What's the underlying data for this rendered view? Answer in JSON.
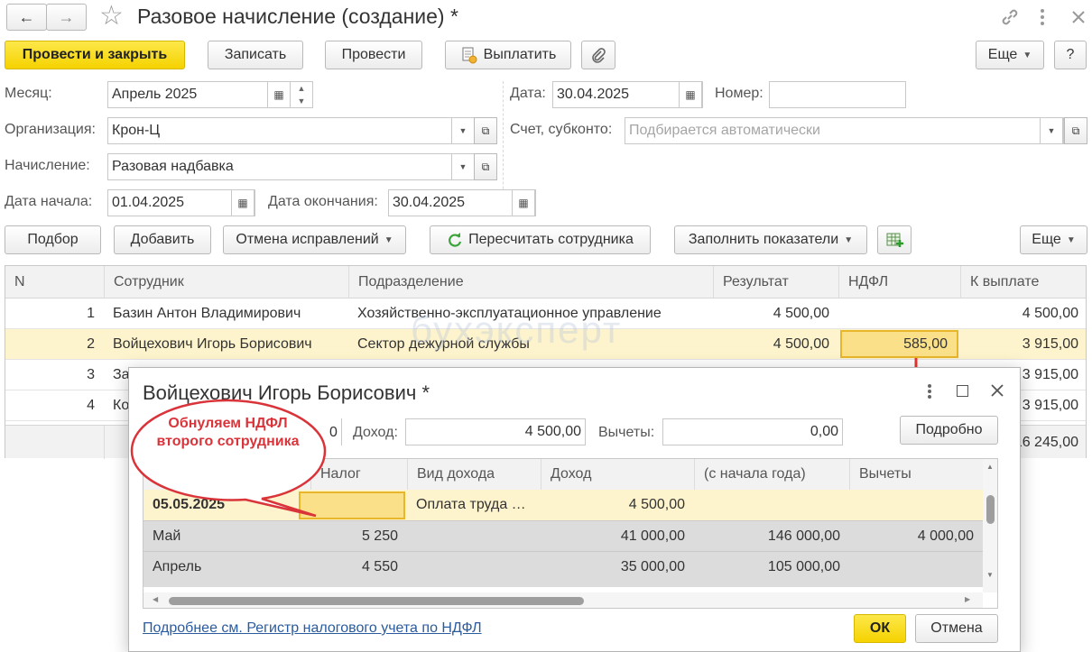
{
  "window": {
    "title": "Разовое начисление (создание) *",
    "nav_back": "←",
    "nav_forward": "→",
    "star": "☆"
  },
  "toolbar": {
    "post_close": "Провести и закрыть",
    "save": "Записать",
    "post": "Провести",
    "pay": "Выплатить",
    "more": "Еще",
    "help": "?"
  },
  "form": {
    "month_label": "Месяц:",
    "month_value": "Апрель 2025",
    "org_label": "Организация:",
    "org_value": "Крон-Ц",
    "accrual_label": "Начисление:",
    "accrual_value": "Разовая надбавка",
    "start_label": "Дата начала:",
    "start_value": "01.04.2025",
    "end_label": "Дата окончания:",
    "end_value": "30.04.2025",
    "date_label": "Дата:",
    "date_value": "30.04.2025",
    "number_label": "Номер:",
    "number_value": "",
    "account_label": "Счет, субконто:",
    "account_placeholder": "Подбирается автоматически"
  },
  "table_toolbar": {
    "pick": "Подбор",
    "add": "Добавить",
    "cancel_fix": "Отмена исправлений",
    "recalc": "Пересчитать сотрудника",
    "fill": "Заполнить показатели",
    "more": "Еще"
  },
  "table": {
    "headers": [
      "N",
      "Сотрудник",
      "Подразделение",
      "Результат",
      "НДФЛ",
      "К выплате"
    ],
    "rows": [
      {
        "n": "1",
        "employee": "Базин Антон Владимирович",
        "dept": "Хозяйственно-эксплуатационное управление",
        "result": "4 500,00",
        "ndfl": "",
        "pay": "4 500,00"
      },
      {
        "n": "2",
        "employee": "Войцехович Игорь Борисович",
        "dept": "Сектор дежурной службы",
        "result": "4 500,00",
        "ndfl": "585,00",
        "pay": "3 915,00"
      },
      {
        "n": "3",
        "employee": "За",
        "dept": "",
        "result": "",
        "ndfl": "",
        "pay": "3 915,00"
      },
      {
        "n": "4",
        "employee": "Ко",
        "dept": "",
        "result": "",
        "ndfl": "",
        "pay": "3 915,00"
      }
    ],
    "total_pay": "16 245,00"
  },
  "watermark": "бухэксперт",
  "dialog": {
    "title": "Войцехович Игорь Борисович *",
    "clipped_value": "0",
    "income_label": "Доход:",
    "income_value": "4 500,00",
    "deductions_label": "Вычеты:",
    "deductions_value": "0,00",
    "details_button": "Подробно",
    "headers": [
      "Налог",
      "Вид дохода",
      "Доход",
      "(с начала года)",
      "Вычеты"
    ],
    "rows": [
      {
        "period": "05.05.2025",
        "tax": "",
        "income_type": "Оплата труда …",
        "income": "4 500,00",
        "ytd": "",
        "deductions": ""
      },
      {
        "period": "Май",
        "tax": "5 250",
        "income_type": "",
        "income": "41 000,00",
        "ytd": "146 000,00",
        "deductions": "4 000,00"
      },
      {
        "period": "Апрель",
        "tax": "4 550",
        "income_type": "",
        "income": "35 000,00",
        "ytd": "105 000,00",
        "deductions": ""
      }
    ],
    "link": "Подробнее см. Регистр налогового учета по НДФЛ",
    "ok": "ОК",
    "cancel": "Отмена"
  },
  "callout": {
    "text": "Обнуляем НДФЛ второго сотрудника",
    "color": "#d9343a"
  },
  "colors": {
    "primary_button": "#f5d200",
    "selected_row": "#fdf3cc",
    "highlight_border": "#e8b62a",
    "link": "#2a5b9e",
    "arrow": "#e8332e"
  }
}
